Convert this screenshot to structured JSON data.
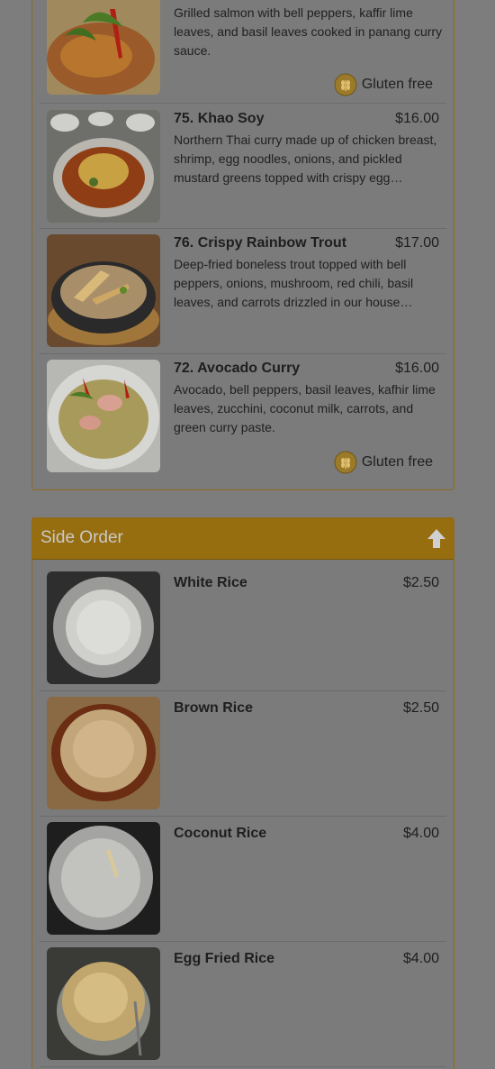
{
  "curry": {
    "items": [
      {
        "name": "",
        "price": "",
        "desc": "Grilled salmon with bell peppers, kaffir lime leaves, and basil leaves cooked in panang curry sauce.",
        "tag": "Gluten free"
      },
      {
        "name": "75. Khao Soy",
        "price": "$16.00",
        "desc": "Northern Thai curry made up of chicken breast, shrimp, egg noodles, onions, and pickled mustard greens topped with crispy egg…"
      },
      {
        "name": "76. Crispy Rainbow Trout",
        "price": "$17.00",
        "desc": "Deep-fried boneless trout topped with bell peppers, onions, mushroom, red chili, basil leaves, and carrots drizzled in our house…"
      },
      {
        "name": "72. Avocado Curry",
        "price": "$16.00",
        "desc": "Avocado, bell peppers, basil leaves, kafhir lime leaves, zucchini, coconut milk, carrots, and green curry paste.",
        "tag": "Gluten free"
      }
    ]
  },
  "side_order": {
    "title": "Side Order",
    "items": [
      {
        "name": "White Rice",
        "price": "$2.50"
      },
      {
        "name": "Brown Rice",
        "price": "$2.50"
      },
      {
        "name": "Coconut Rice",
        "price": "$4.00"
      },
      {
        "name": "Egg Fried Rice",
        "price": "$4.00"
      }
    ]
  },
  "icons": {
    "gluten_free": "wheat-icon",
    "scroll_up": "arrow-up-icon"
  },
  "colors": {
    "header": "#966d0f",
    "header_text": "#c9c9c9",
    "background": "#7d7d7d"
  }
}
